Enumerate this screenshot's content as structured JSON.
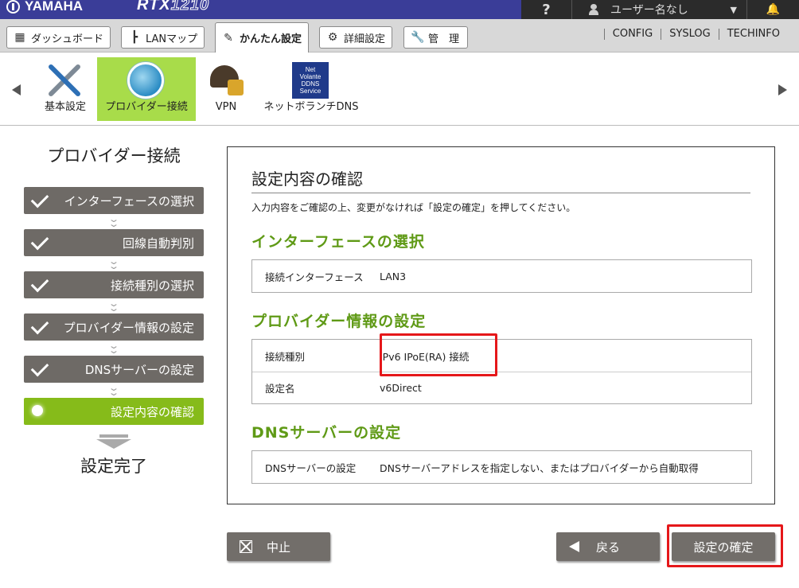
{
  "header": {
    "brand": "YAMAHA",
    "model_prefix": "RTX",
    "model_number": "1210",
    "help": "?",
    "user": "ユーザー名なし",
    "caret": "▼",
    "bell": "🔔"
  },
  "nav": {
    "tabs": [
      {
        "label": "ダッシュボード",
        "icon": "dashboard-icon"
      },
      {
        "label": "LANマップ",
        "icon": "lanmap-icon"
      },
      {
        "label": "かんたん設定",
        "icon": "wizard-icon",
        "active": true
      },
      {
        "label": "詳細設定",
        "icon": "gear-icon"
      },
      {
        "label": "管　理",
        "icon": "wrench-icon"
      }
    ],
    "links": [
      "CONFIG",
      "SYSLOG",
      "TECHINFO"
    ]
  },
  "categories": [
    {
      "label": "基本設定",
      "icon": "tools-icon"
    },
    {
      "label": "プロバイダー接続",
      "icon": "globe-icon",
      "selected": true
    },
    {
      "label": "VPN",
      "icon": "vpn-lock-icon"
    },
    {
      "label": "ネットボランチDNS",
      "icon": "ddns-icon",
      "badge_lines": [
        "Net",
        "Volante",
        "DDNS",
        "Service"
      ]
    }
  ],
  "sidebar": {
    "title": "プロバイダー接続",
    "steps": [
      {
        "label": "インターフェースの選択",
        "status": "done"
      },
      {
        "label": "回線自動判別",
        "status": "done"
      },
      {
        "label": "接続種別の選択",
        "status": "done"
      },
      {
        "label": "プロバイダー情報の設定",
        "status": "done"
      },
      {
        "label": "DNSサーバーの設定",
        "status": "done"
      },
      {
        "label": "設定内容の確認",
        "status": "current"
      }
    ],
    "final": "設定完了"
  },
  "main": {
    "title": "設定内容の確認",
    "description": "入力内容をご確認の上、変更がなければ「設定の確定」を押してください。",
    "sections": [
      {
        "heading": "インターフェースの選択",
        "rows": [
          {
            "key": "接続インターフェース",
            "value": "LAN3"
          }
        ]
      },
      {
        "heading": "プロバイダー情報の設定",
        "rows": [
          {
            "key": "接続種別",
            "value": "IPv6 IPoE(RA) 接続"
          },
          {
            "key": "設定名",
            "value": "v6Direct"
          }
        ]
      },
      {
        "heading": "DNSサーバーの設定",
        "rows": [
          {
            "key": "DNSサーバーの設定",
            "value": "DNSサーバーアドレスを指定しない、またはプロバイダーから自動取得"
          }
        ]
      }
    ]
  },
  "buttons": {
    "cancel": "中止",
    "back": "戻る",
    "confirm": "設定の確定"
  },
  "colors": {
    "header_bg": "#3a3d98",
    "accent_green": "#86bb1a",
    "section_green": "#5f9a16",
    "step_gray": "#6e6a66",
    "highlight_red": "#e5171a"
  }
}
